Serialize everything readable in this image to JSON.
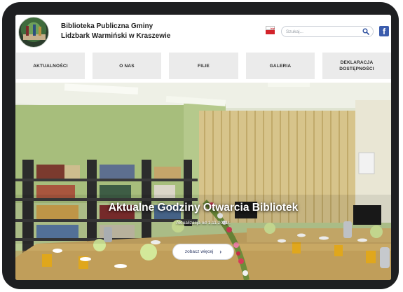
{
  "header": {
    "title_line1": "Biblioteka Publiczna Gminy",
    "title_line2": "Lidzbark Warmiński w Kraszewie",
    "bip_label": "bip",
    "search_placeholder": "Szukaj...",
    "facebook_letter": "f"
  },
  "nav": {
    "items": [
      {
        "label": "AKTUALNOŚCI"
      },
      {
        "label": "O NAS"
      },
      {
        "label": "FILIE"
      },
      {
        "label": "GALERIA"
      },
      {
        "label": "DEKLARACJA DOSTĘPNOŚCI"
      }
    ]
  },
  "hero": {
    "title": "Aktualne Godziny Otwarcia Bibliotek",
    "subtitle": "Aktualizacja od 1.11.2021r.",
    "button_label": "zobacz więcej",
    "button_chevron": "›"
  },
  "colors": {
    "nav_bg": "#ebebeb",
    "accent_facebook": "#3b5cad",
    "button_text": "#2d3a66"
  }
}
